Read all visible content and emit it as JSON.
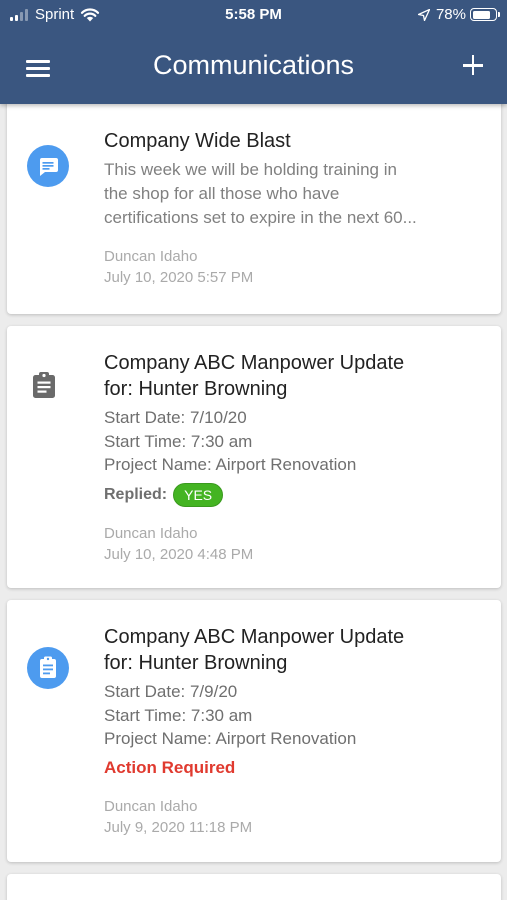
{
  "status_bar": {
    "carrier": "Sprint",
    "time": "5:58 PM",
    "battery": "78%",
    "icons": [
      "signal-icon",
      "wifi-icon",
      "location-arrow-icon",
      "battery-icon"
    ]
  },
  "app_bar": {
    "title": "Communications",
    "icons": [
      "hamburger-menu-icon",
      "plus-icon"
    ]
  },
  "colors": {
    "header": "#3a5680",
    "icon_circle": "#4d9bef",
    "yes_badge": "#44b422",
    "action_required": "#e03a2f"
  },
  "communications": [
    {
      "icon": "message-icon",
      "title": "Company Wide Blast",
      "preview_lines": [
        "This week we will be holding training in",
        "the shop for all those who have",
        "certifications set to expire in the next 60..."
      ],
      "author": "Duncan Idaho",
      "timestamp": "July 10, 2020 5:57 PM"
    },
    {
      "icon": "clipboard-icon",
      "title_lines": [
        "Company ABC Manpower Update",
        "for: Hunter Browning"
      ],
      "details": [
        "Start Date: 7/10/20",
        "Start Time: 7:30 am",
        "Project Name: Airport Renovation"
      ],
      "replied_label": "Replied:",
      "replied_value": "YES",
      "author": "Duncan Idaho",
      "timestamp": "July 10, 2020 4:48 PM"
    },
    {
      "icon": "clipboard-icon",
      "title_lines": [
        "Company ABC Manpower Update",
        "for: Hunter Browning"
      ],
      "details": [
        "Start Date: 7/9/20",
        "Start Time: 7:30 am",
        "Project Name: Airport Renovation"
      ],
      "status": "Action Required",
      "author": "Duncan Idaho",
      "timestamp": "July 9, 2020 11:18 PM"
    }
  ]
}
